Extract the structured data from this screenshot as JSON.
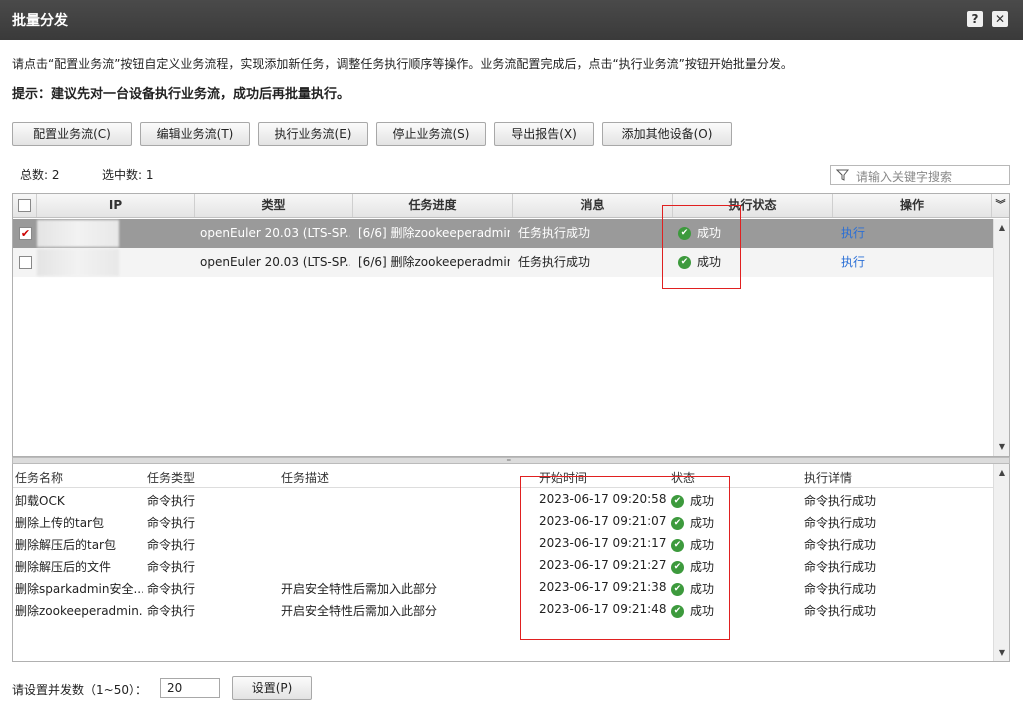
{
  "window": {
    "title": "批量分发",
    "help_label": "?",
    "close_label": "✕"
  },
  "intro_text": "请点击“配置业务流”按钮自定义业务流程，实现添加新任务，调整任务执行顺序等操作。业务流配置完成后，点击“执行业务流”按钮开始批量分发。",
  "hint_text": "提示：建议先对一台设备执行业务流，成功后再批量执行。",
  "toolbar": [
    {
      "label": "配置业务流(C)"
    },
    {
      "label": "编辑业务流(T)"
    },
    {
      "label": "执行业务流(E)"
    },
    {
      "label": "停止业务流(S)"
    },
    {
      "label": "导出报告(X)"
    },
    {
      "label": "添加其他设备(O)"
    }
  ],
  "counts": {
    "total": "总数: 2",
    "selected": "选中数: 1"
  },
  "search": {
    "placeholder": "请输入关键字搜索",
    "icon": "filter-icon"
  },
  "device_grid": {
    "columns": [
      "IP",
      "类型",
      "任务进度",
      "消息",
      "执行状态",
      "操作"
    ],
    "rows": [
      {
        "checked": true,
        "selected": true,
        "type": "openEuler 20.03 (LTS-SP...",
        "progress": "[6/6] 删除zookeeperadmin...",
        "message": "任务执行成功",
        "status": "成功",
        "action": "执行"
      },
      {
        "checked": false,
        "selected": false,
        "type": "openEuler 20.03 (LTS-SP...",
        "progress": "[6/6] 删除zookeeperadmin...",
        "message": "任务执行成功",
        "status": "成功",
        "action": "执行"
      }
    ]
  },
  "task_grid": {
    "columns": [
      "任务名称",
      "任务类型",
      "任务描述",
      "开始时间",
      "状态",
      "执行详情"
    ],
    "rows": [
      {
        "name": "卸载OCK",
        "type": "命令执行",
        "desc": "",
        "start": "2023-06-17 09:20:58",
        "status": "成功",
        "detail": "命令执行成功"
      },
      {
        "name": "删除上传的tar包",
        "type": "命令执行",
        "desc": "",
        "start": "2023-06-17 09:21:07",
        "status": "成功",
        "detail": "命令执行成功"
      },
      {
        "name": "删除解压后的tar包",
        "type": "命令执行",
        "desc": "",
        "start": "2023-06-17 09:21:17",
        "status": "成功",
        "detail": "命令执行成功"
      },
      {
        "name": "删除解压后的文件",
        "type": "命令执行",
        "desc": "",
        "start": "2023-06-17 09:21:27",
        "status": "成功",
        "detail": "命令执行成功"
      },
      {
        "name": "删除sparkadmin安全...",
        "type": "命令执行",
        "desc": "开启安全特性后需加入此部分",
        "start": "2023-06-17 09:21:38",
        "status": "成功",
        "detail": "命令执行成功"
      },
      {
        "name": "删除zookeeperadmin...",
        "type": "命令执行",
        "desc": "开启安全特性后需加入此部分",
        "start": "2023-06-17 09:21:48",
        "status": "成功",
        "detail": "命令执行成功"
      }
    ]
  },
  "footer": {
    "label": "请设置并发数（1~50）：",
    "value": "20",
    "button": "设置(P)"
  },
  "colors": {
    "titlebar": "#3f3f3f",
    "selected_row": "#9a9a9a",
    "success": "#3d9a3d",
    "link": "#2a6fd6",
    "highlight_box": "#e02020"
  }
}
